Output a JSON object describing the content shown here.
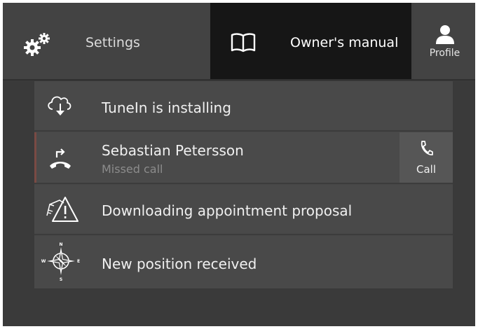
{
  "topbar": {
    "settings": {
      "label": "Settings",
      "icon": "gears-icon"
    },
    "owners_manual": {
      "label": "Owner's manual",
      "icon": "book-icon"
    },
    "profile": {
      "label": "Profile",
      "icon": "person-icon"
    }
  },
  "notifications": [
    {
      "title": "TuneIn is installing",
      "icon": "cloud-download-icon"
    },
    {
      "title": "Sebastian Petersson",
      "subtitle": "Missed call",
      "icon": "missed-call-icon",
      "action": {
        "label": "Call",
        "icon": "phone-icon"
      }
    },
    {
      "title": "Downloading appointment proposal",
      "icon": "warning-icon"
    },
    {
      "title": "New position received",
      "icon": "compass-icon"
    }
  ],
  "colors": {
    "background": "#3a3a3a",
    "active_tab": "#161616",
    "missed_call_accent": "#7a4a44"
  }
}
